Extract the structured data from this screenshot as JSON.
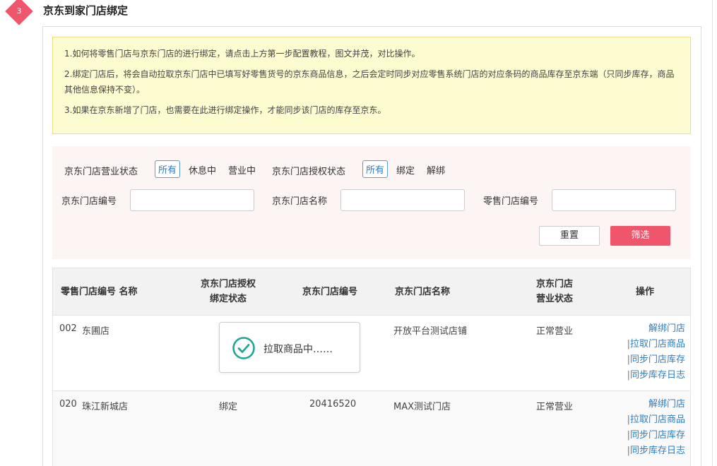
{
  "section": {
    "step": "3",
    "title": "京东到家门店绑定"
  },
  "notice": {
    "line1": "1.如何将零售门店与京东门店的进行绑定，请点击上方第一步配置教程，图文并茂，对比操作。",
    "line2": "2.绑定门店后，将会自动拉取京东门店中已填写好零售货号的京东商品信息，之后会定时同步对应零售系统门店的对应条码的商品库存至京东端（只同步库存，商品其他信息保持不变）。",
    "line3": "3.如果在京东新增了门店，也需要在此进行绑定操作，才能同步该门店的库存至京东。"
  },
  "filters": {
    "business_status_label": "京东门店营业状态",
    "business_status_options": [
      "所有",
      "休息中",
      "营业中"
    ],
    "business_status_selected": "所有",
    "auth_status_label": "京东门店授权状态",
    "auth_status_options": [
      "所有",
      "绑定",
      "解绑"
    ],
    "auth_status_selected": "所有",
    "jd_store_no_label": "京东门店编号",
    "jd_store_no_value": "",
    "jd_store_name_label": "京东门店名称",
    "jd_store_name_value": "",
    "retail_store_no_label": "零售门店编号",
    "retail_store_no_value": "",
    "reset_label": "重置",
    "filter_label": "筛选"
  },
  "table": {
    "headers": {
      "col1": "零售门店编号 名称",
      "col2_line1": "京东门店授权",
      "col2_line2": "绑定状态",
      "col3": "京东门店编号",
      "col4": "京东门店名称",
      "col5_line1": "京东门店",
      "col5_line2": "营业状态",
      "col6": "操作"
    },
    "rows": [
      {
        "retail_code": "002",
        "retail_name": "东圃店",
        "bind_status": "",
        "jd_code": "",
        "jd_name": "开放平台测试店铺",
        "jd_biz_status": "正常营业"
      },
      {
        "retail_code": "020",
        "retail_name": "珠江新城店",
        "bind_status": "绑定",
        "jd_code": "20416520",
        "jd_name": "MAX测试门店",
        "jd_biz_status": "正常营业"
      }
    ],
    "actions": {
      "unbind": "解绑门店",
      "pull": "拉取门店商品",
      "sync": "同步门店库存",
      "log": "同步库存日志",
      "separator": "|"
    }
  },
  "toast": {
    "text": "拉取商品中……",
    "icon": "check-circle-icon",
    "color": "#1fa88f"
  },
  "colors": {
    "accent": "#f0566b",
    "link": "#2f7dc1",
    "notice_bg": "#fdfbd0",
    "filter_bg": "#fdf4f4"
  }
}
